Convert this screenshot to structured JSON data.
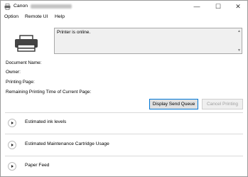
{
  "window": {
    "title": "Canon",
    "min_glyph": "—",
    "max_glyph": "☐",
    "close_glyph": "✕"
  },
  "menu": [
    "Option",
    "Remote UI",
    "Help"
  ],
  "status": {
    "message": "Printer is online.",
    "scroll_up": "▲",
    "scroll_down": "▼"
  },
  "info": {
    "document_name": "Document Name:",
    "owner": "Owner:",
    "printing_page": "Printing Page:",
    "remaining_time": "Remaining Printing Time of Current Page:"
  },
  "buttons": {
    "display_send_queue": "Display Send Queue",
    "cancel_printing": "Cancel Printing"
  },
  "sections": [
    {
      "label": "Estimated ink levels"
    },
    {
      "label": "Estimated Maintenance Cartridge Usage"
    },
    {
      "label": "Paper Feed"
    }
  ],
  "icons": {
    "app": "printer-app-icon",
    "printer": "printer-icon",
    "expand": "expand-arrow-icon"
  }
}
